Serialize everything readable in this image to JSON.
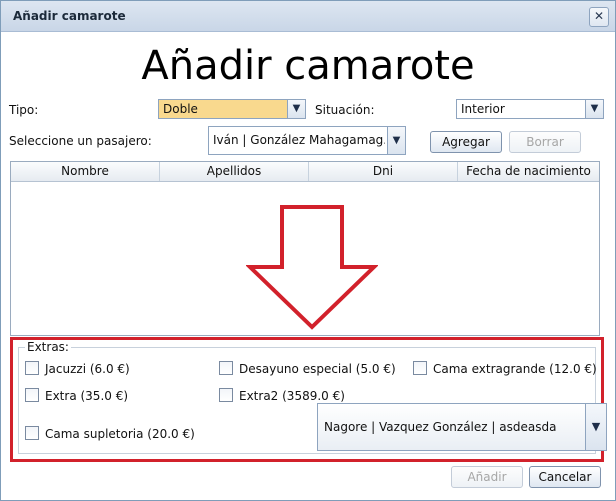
{
  "window": {
    "title": "Añadir camarote",
    "close_label": "✕"
  },
  "heading": "Añadir camarote",
  "tipo": {
    "label": "Tipo:",
    "value": "Doble"
  },
  "situacion": {
    "label": "Situación:",
    "value": "Interior"
  },
  "pasajero": {
    "label": "Seleccione un pasajero:",
    "value": "Iván | González Mahagamag..."
  },
  "buttons": {
    "agregar": "Agregar",
    "borrar": "Borrar",
    "anadir": "Añadir",
    "cancelar": "Cancelar"
  },
  "table": {
    "columns": [
      "Nombre",
      "Apellidos",
      "Dni",
      "Fecha de nacimiento"
    ],
    "rows": []
  },
  "extras": {
    "legend": "Extras:",
    "items": [
      "Jacuzzi (6.0 €)",
      "Desayuno especial (5.0 €)",
      "Cama extragrande (12.0 €)",
      "Extra (35.0 €)",
      "Extra2 (3589.0 €)",
      "Cama supletoria (20.0 €)"
    ],
    "selected_passenger": "Nagore | Vazquez González | asdeasda"
  },
  "icons": {
    "dropdown": "▼"
  },
  "colors": {
    "highlight": "#d2212b",
    "selected_combo": "#f9d98e"
  }
}
